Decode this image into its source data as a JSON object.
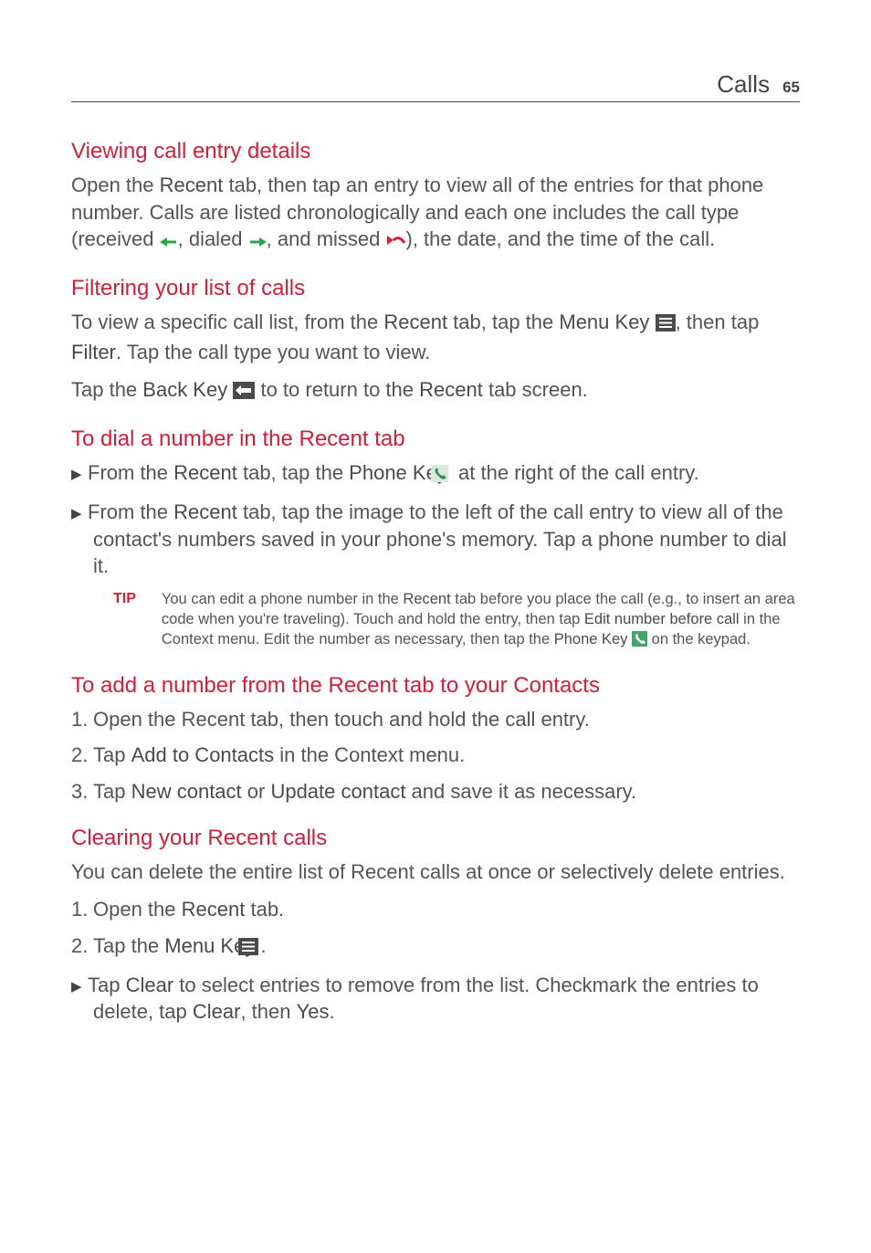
{
  "header": {
    "title": "Calls",
    "page": "65"
  },
  "s1": {
    "h": "Viewing call entry details",
    "p_a": "Open the ",
    "p_b": "Recent",
    "p_c": " tab, then tap an entry to view all of the entries for that phone number. Calls are listed chronologically and each one includes the call type (received ",
    "p_d": ", dialed ",
    "p_e": ", and missed ",
    "p_f": "), the date, and the time of the call."
  },
  "s2": {
    "h": "Filtering your list of calls",
    "p1_a": "To view a specific call list, from the ",
    "p1_b": "Recent",
    "p1_c": " tab, tap the ",
    "p1_d": "Menu Key",
    "p1_e": " ",
    "p1_f": ", then tap ",
    "p1_g": "Filter",
    "p1_h": ". Tap the call type you want to view.",
    "p2_a": "Tap the ",
    "p2_b": "Back Key",
    "p2_c": " ",
    "p2_d": " to to return to the ",
    "p2_e": "Recent",
    "p2_f": " tab screen."
  },
  "s3": {
    "h": "To dial a number in the Recent tab",
    "b1_a": "From the ",
    "b1_b": "Recent",
    "b1_c": " tab, tap the ",
    "b1_d": "Phone Key",
    "b1_e": " ",
    "b1_f": " at the right of the call entry.",
    "b2_a": "From the ",
    "b2_b": "Recent",
    "b2_c": " tab, tap the image to the left of the call entry to view all of the contact's numbers saved in your phone's memory. Tap a phone number to dial it."
  },
  "tip": {
    "label": "TIP",
    "t_a": "You can edit a phone number in the ",
    "t_b": "Recent",
    "t_c": " tab before you place the call (e.g., to insert an area code when you're traveling). Touch and hold the entry, then tap ",
    "t_d": "Edit number before call",
    "t_e": " in the Context menu. Edit the number as necessary, then tap the ",
    "t_f": "Phone Key",
    "t_g": " ",
    "t_h": " on the keypad."
  },
  "s4": {
    "h": "To add a number from the Recent tab to your Contacts",
    "n1": "Open the Recent tab, then touch and hold the call entry.",
    "n2_a": "Tap ",
    "n2_b": "Add to Contacts",
    "n2_c": " in the Context menu.",
    "n3_a": "Tap ",
    "n3_b": "New contact",
    "n3_c": " or ",
    "n3_d": "Update contact",
    "n3_e": " and save it as necessary."
  },
  "s5": {
    "h": "Clearing your Recent calls",
    "p": "You can delete the entire list of Recent calls at once or selectively delete entries.",
    "n1_a": "Open the ",
    "n1_b": "Recent",
    "n1_c": " tab.",
    "n2_a": "Tap the ",
    "n2_b": "Menu Key",
    "n2_c": " ",
    "n2_d": ".",
    "sb_a": "Tap ",
    "sb_b": "Clear",
    "sb_c": " to select entries to remove from the list. Checkmark the entries to delete, tap ",
    "sb_d": "Clear",
    "sb_e": ", then ",
    "sb_f": "Yes",
    "sb_g": "."
  },
  "markers": {
    "bullet": "▶",
    "n1": "1.",
    "n2": "2.",
    "n3": "3."
  }
}
